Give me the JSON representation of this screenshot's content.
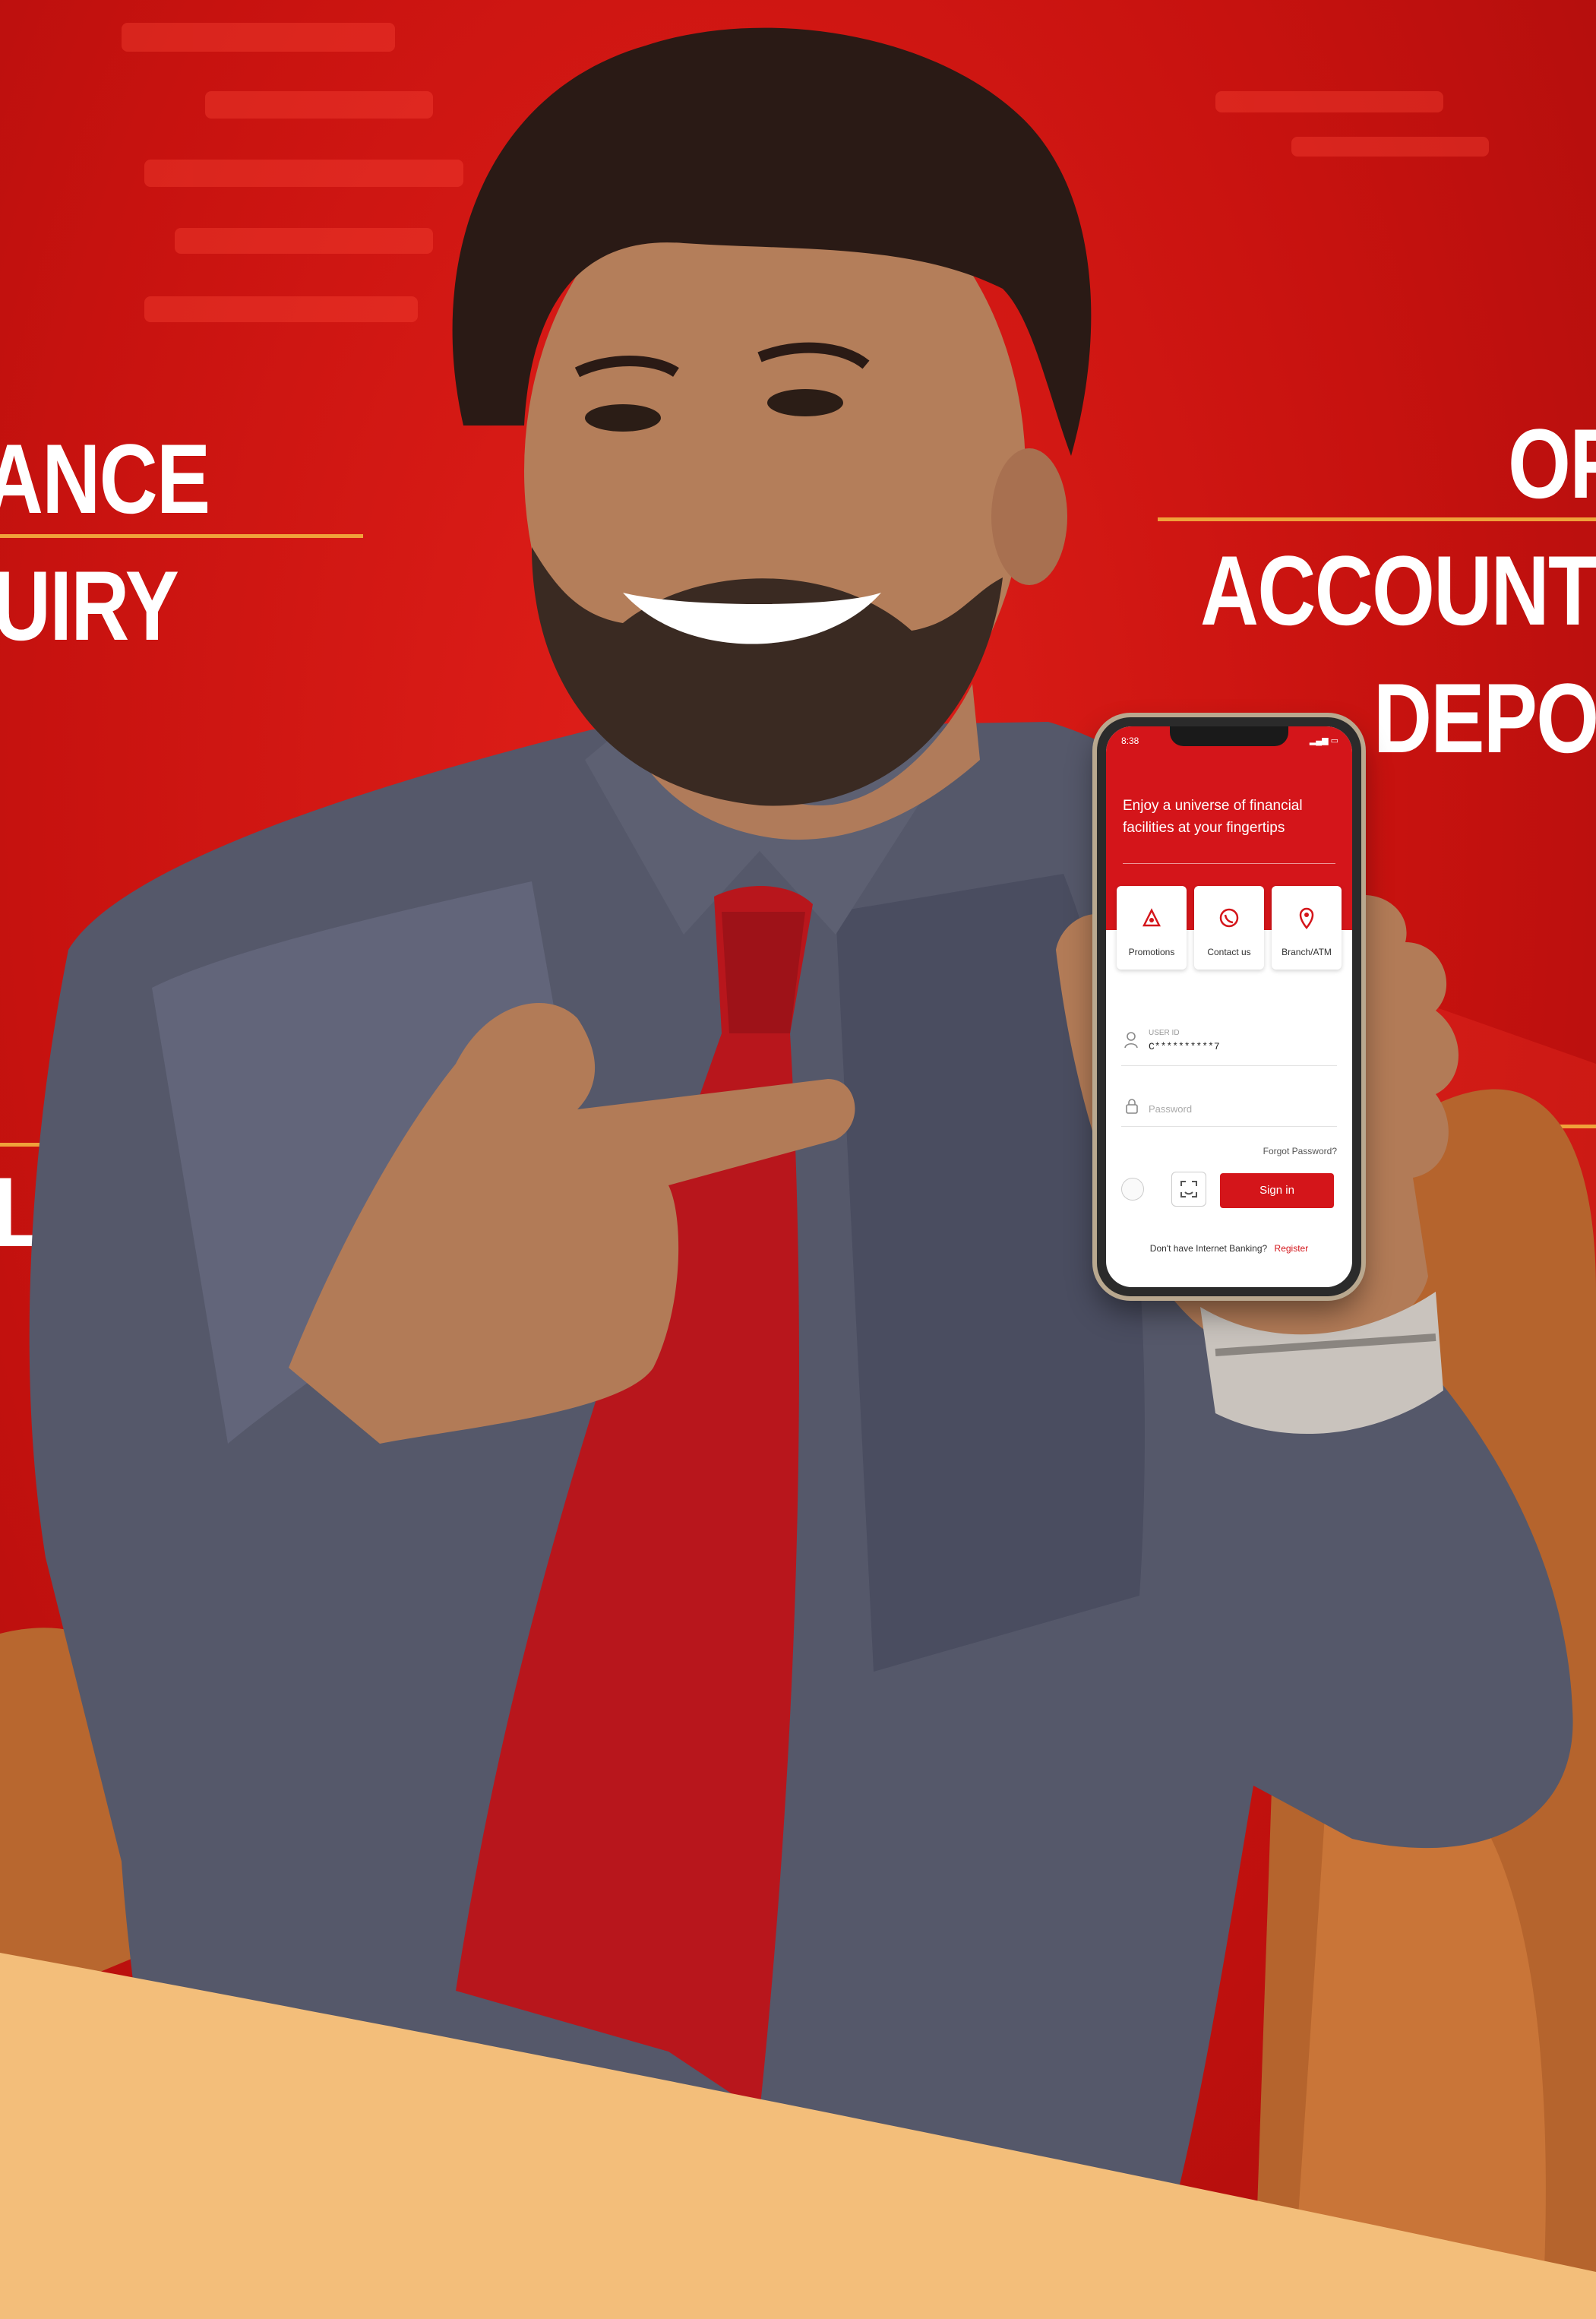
{
  "banner": {
    "left_top_line1": "ANCE",
    "left_top_line2": "UIRY",
    "left_bottom": "LS",
    "right_line1": "OF",
    "right_line2": "ACCOUNT",
    "right_line3": "DEPO",
    "accent_color": "#f0a23a",
    "background_color": "#c8120f"
  },
  "phone": {
    "status_time": "8:38",
    "tagline": "Enjoy a universe of financial facilities at your fingertips",
    "quick_actions": [
      {
        "label": "Promotions",
        "icon": "promotions-icon"
      },
      {
        "label": "Contact us",
        "icon": "contact-icon"
      },
      {
        "label": "Branch/ATM",
        "icon": "branch-atm-icon"
      }
    ],
    "user_id_label": "USER ID",
    "user_id_value": "C**********7",
    "password_placeholder": "Password",
    "forgot_password": "Forgot Password?",
    "sign_in": "Sign in",
    "register_prompt": "Don't have Internet Banking?",
    "register_link": "Register",
    "brand_color": "#d4151a"
  }
}
